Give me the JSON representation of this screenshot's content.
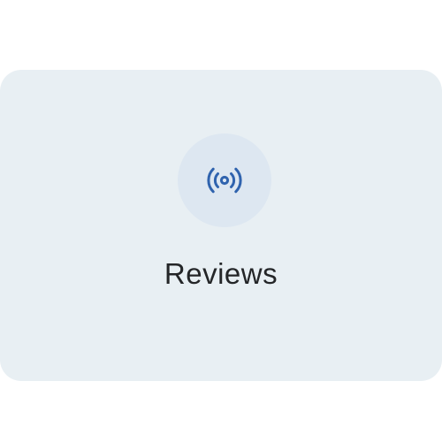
{
  "tile": {
    "label": "Reviews",
    "icon": "broadcast-icon",
    "colors": {
      "card_background": "#e8eff3",
      "icon_circle": "#dde7f1",
      "icon_accent": "#2f63ae",
      "label_text": "#242628"
    }
  }
}
